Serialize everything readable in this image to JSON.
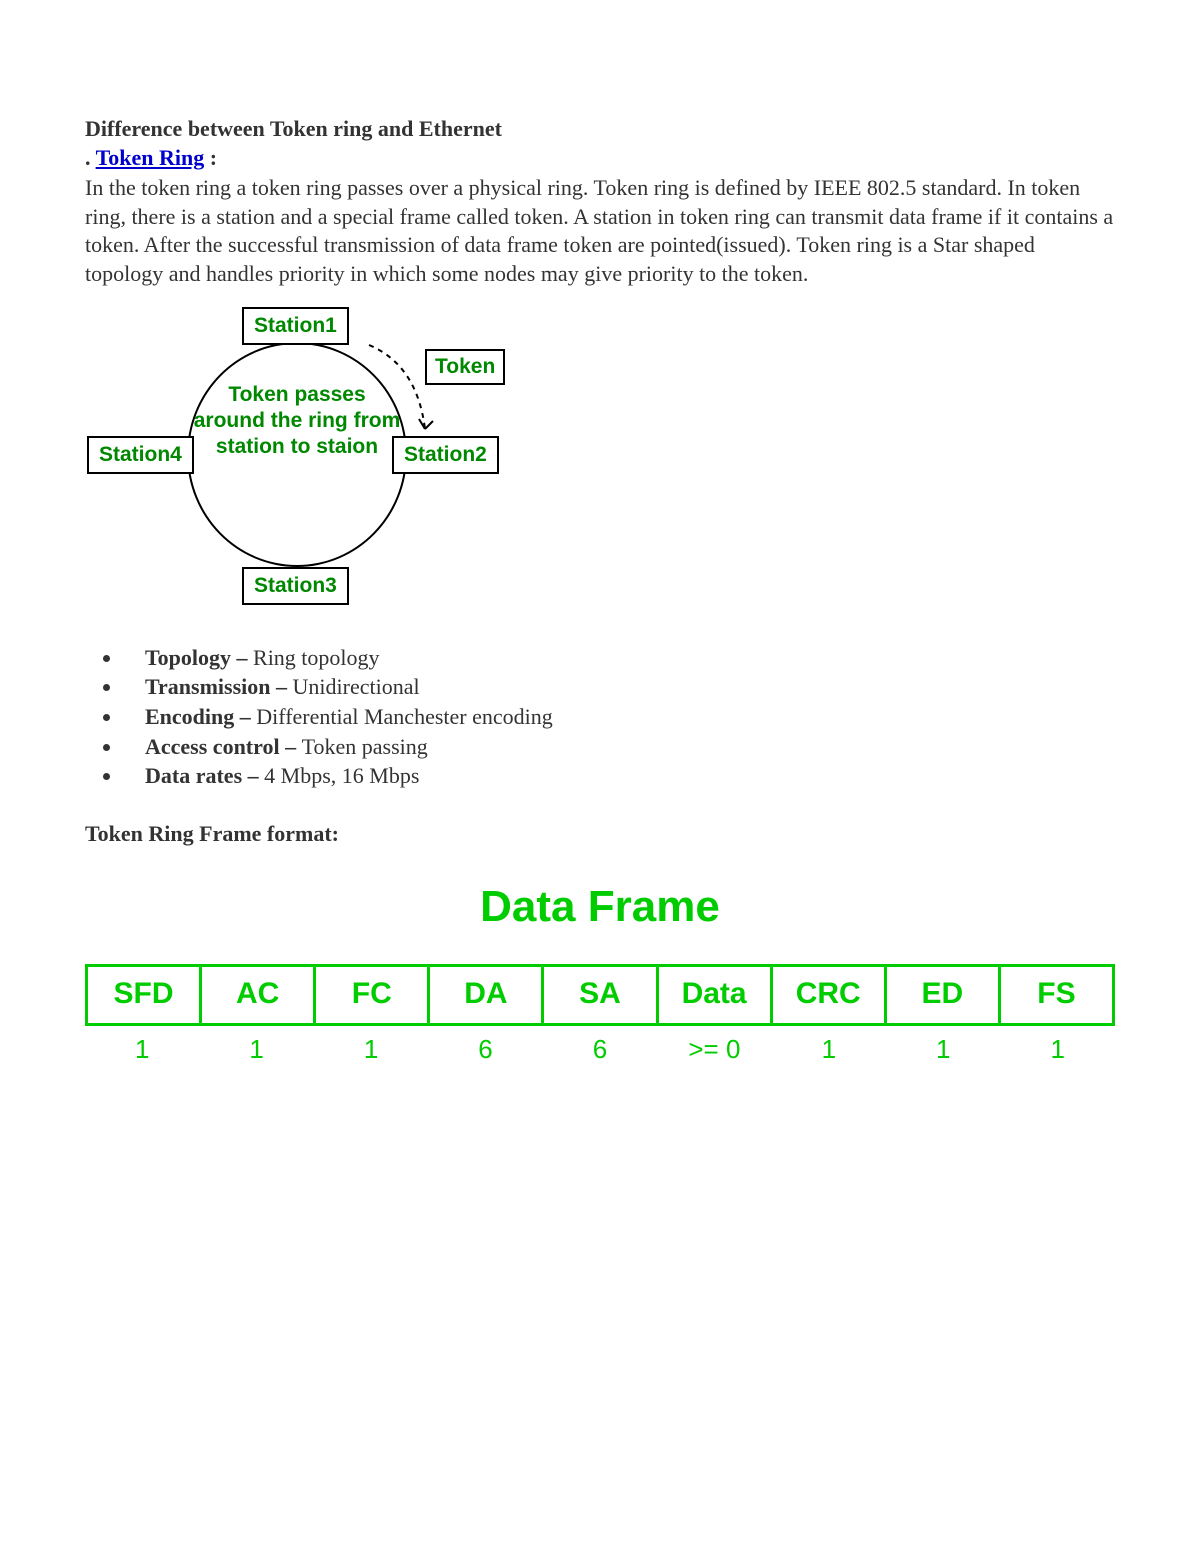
{
  "title": "Difference between Token ring and Ethernet",
  "token_ring_link": "Token Ring",
  "dot": ". ",
  "colon": " :",
  "intro_paragraph": "In the token ring a token ring passes over a physical ring. Token ring is defined by IEEE 802.5 standard. In token ring, there is a station and a special frame called token. A station in token ring can transmit data frame if it contains a token. After the successful transmission of data frame token are pointed(issued). Token ring is a Star shaped topology and handles priority in which some nodes may give priority to the token.",
  "ring": {
    "station1": "Station1",
    "station2": "Station2",
    "station3": "Station3",
    "station4": "Station4",
    "token": "Token",
    "center": "Token passes around the ring from station to staion"
  },
  "bullets": [
    {
      "label": "Topology – ",
      "value": "Ring topology"
    },
    {
      "label": "Transmission – ",
      "value": "Unidirectional"
    },
    {
      "label": "Encoding – ",
      "value": "Differential Manchester encoding"
    },
    {
      "label": "Access control – ",
      "value": "Token passing"
    },
    {
      "label": "Data rates – ",
      "value": "4 Mbps, 16 Mbps"
    }
  ],
  "frame_format_heading": "Token Ring Frame format:",
  "data_frame": {
    "title": "Data Frame",
    "fields": [
      "SFD",
      "AC",
      "FC",
      "DA",
      "SA",
      "Data",
      "CRC",
      "ED",
      "FS"
    ],
    "sizes": [
      "1",
      "1",
      "1",
      "6",
      "6",
      ">= 0",
      "1",
      "1",
      "1"
    ]
  },
  "chart_data": [
    {
      "type": "table",
      "title": "Token Ring Data Frame fields (bytes)",
      "categories": [
        "SFD",
        "AC",
        "FC",
        "DA",
        "SA",
        "Data",
        "CRC",
        "ED",
        "FS"
      ],
      "values": [
        "1",
        "1",
        "1",
        "6",
        "6",
        ">= 0",
        "1",
        "1",
        "1"
      ]
    }
  ]
}
